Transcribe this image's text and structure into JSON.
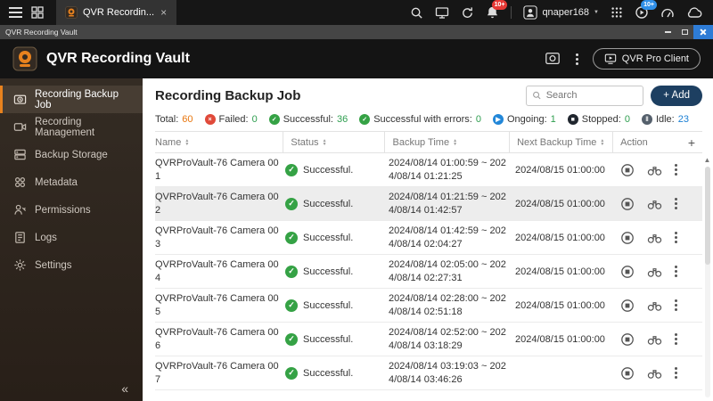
{
  "icons": {
    "tab_close": "×",
    "caret_down": "▼",
    "sort_up": "▲",
    "sort_down": "▼",
    "scroll_up": "▲",
    "collapse": "«",
    "check": "✓",
    "plus": "+"
  },
  "topbar": {
    "tab_title": "QVR Recordin...",
    "user_name": "qnaper168",
    "notification_badge": "10+",
    "task_badge": "10+"
  },
  "window_bar": {
    "title": "QVR Recording Vault"
  },
  "app_header": {
    "title": "QVR Recording Vault",
    "pro_client_label": "QVR Pro Client"
  },
  "sidebar": {
    "items": [
      {
        "label": "Recording Backup Job"
      },
      {
        "label": "Recording Management"
      },
      {
        "label": "Backup Storage"
      },
      {
        "label": "Metadata"
      },
      {
        "label": "Permissions"
      },
      {
        "label": "Logs"
      },
      {
        "label": "Settings"
      }
    ]
  },
  "main": {
    "title": "Recording Backup Job",
    "search_placeholder": "Search",
    "add_label": "+ Add",
    "stats": [
      {
        "label": "Total:",
        "value": "60",
        "value_color": "#e8750d"
      },
      {
        "label": "Failed:",
        "value": "0",
        "value_color": "#2e9e4f",
        "icon_color": "#e04a3a",
        "glyph": "×"
      },
      {
        "label": "Successful:",
        "value": "36",
        "value_color": "#2e9e4f",
        "icon_color": "#35a245",
        "glyph": "✓"
      },
      {
        "label": "Successful with errors:",
        "value": "0",
        "value_color": "#2e9e4f",
        "icon_color": "#35a245",
        "glyph": "✓"
      },
      {
        "label": "Ongoing:",
        "value": "1",
        "value_color": "#2e9e4f",
        "icon_color": "#2287d8",
        "glyph": "▶"
      },
      {
        "label": "Stopped:",
        "value": "0",
        "value_color": "#2e9e4f",
        "icon_color": "#20262e",
        "glyph": "■"
      },
      {
        "label": "Idle:",
        "value": "23",
        "value_color": "#1a7fd4",
        "icon_color": "#55606c",
        "glyph": "‖"
      }
    ],
    "table": {
      "headers": {
        "name": "Name",
        "status": "Status",
        "backup_time": "Backup Time",
        "next_backup_time": "Next Backup Time",
        "action": "Action"
      },
      "rows": [
        {
          "name": "QVRProVault-76 Camera 001",
          "status": "Successful.",
          "backup_time": "2024/08/14 01:00:59 ~ 2024/08/14 01:21:25",
          "next_backup_time": "2024/08/15 01:00:00"
        },
        {
          "name": "QVRProVault-76 Camera 002",
          "status": "Successful.",
          "backup_time": "2024/08/14 01:21:59 ~ 2024/08/14 01:42:57",
          "next_backup_time": "2024/08/15 01:00:00"
        },
        {
          "name": "QVRProVault-76 Camera 003",
          "status": "Successful.",
          "backup_time": "2024/08/14 01:42:59 ~ 2024/08/14 02:04:27",
          "next_backup_time": "2024/08/15 01:00:00"
        },
        {
          "name": "QVRProVault-76 Camera 004",
          "status": "Successful.",
          "backup_time": "2024/08/14 02:05:00 ~ 2024/08/14 02:27:31",
          "next_backup_time": "2024/08/15 01:00:00"
        },
        {
          "name": "QVRProVault-76 Camera 005",
          "status": "Successful.",
          "backup_time": "2024/08/14 02:28:00 ~ 2024/08/14 02:51:18",
          "next_backup_time": "2024/08/15 01:00:00"
        },
        {
          "name": "QVRProVault-76 Camera 006",
          "status": "Successful.",
          "backup_time": "2024/08/14 02:52:00 ~ 2024/08/14 03:18:29",
          "next_backup_time": "2024/08/15 01:00:00"
        },
        {
          "name": "QVRProVault-76 Camera 007",
          "status": "Successful.",
          "backup_time": "2024/08/14 03:19:03 ~ 2024/08/14 03:46:26",
          "next_backup_time": ""
        }
      ]
    }
  }
}
